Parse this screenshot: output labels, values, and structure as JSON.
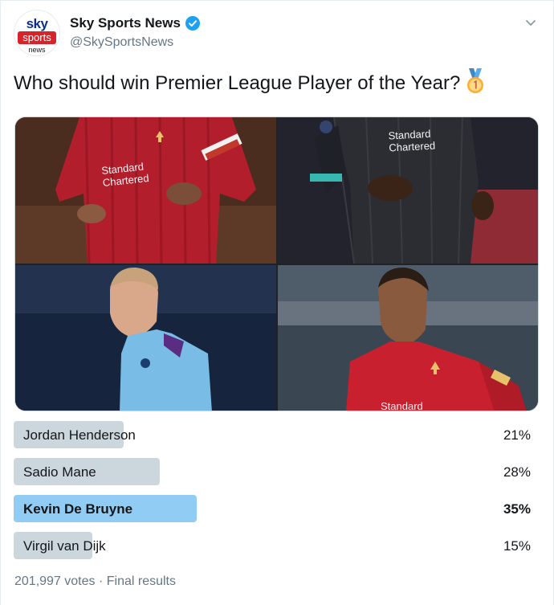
{
  "account": {
    "avatar": {
      "top": "sky",
      "middle": "sports",
      "bottom": "news"
    },
    "name": "Sky Sports News",
    "handle": "@SkySportsNews",
    "verified": true
  },
  "tweet": {
    "text": "Who should win Premier League Player of the Year?",
    "emoji": "1st-place-medal-icon"
  },
  "media": {
    "photos": [
      {
        "sponsor": "Standard\nChartered"
      },
      {
        "sponsor": "Standard\nChartered"
      },
      {
        "sponsor": ""
      },
      {
        "sponsor": "Standard"
      }
    ]
  },
  "poll": {
    "options": [
      {
        "label": "Jordan Henderson",
        "percent": "21%",
        "value": 21,
        "winner": false
      },
      {
        "label": "Sadio Mane",
        "percent": "28%",
        "value": 28,
        "winner": false
      },
      {
        "label": "Kevin De Bruyne",
        "percent": "35%",
        "value": 35,
        "winner": true
      },
      {
        "label": "Virgil van Dijk",
        "percent": "15%",
        "value": 15,
        "winner": false
      }
    ],
    "summary": "201,997 votes · Final results"
  },
  "colors": {
    "accent": "#1da1f2",
    "winner_bar": "#91ccf5",
    "bar": "#ccd6dd",
    "secondary_text": "#657786"
  }
}
